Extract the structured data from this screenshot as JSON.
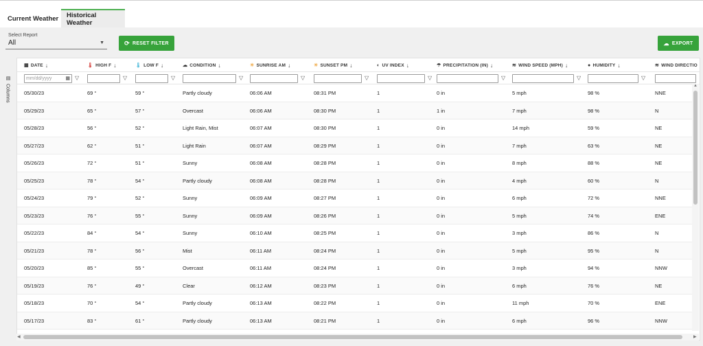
{
  "tabs": [
    {
      "label": "Current Weather"
    },
    {
      "label": "Historical Weather"
    }
  ],
  "report": {
    "label": "Select Report",
    "value": "All"
  },
  "buttons": {
    "reset": "RESET FILTER",
    "export": "EXPORT"
  },
  "sidebar": {
    "columns_label": "Columns"
  },
  "columns": [
    {
      "label": "DATE",
      "icon": "calendar-icon"
    },
    {
      "label": "HIGH F",
      "icon": "thermometer-hot-icon"
    },
    {
      "label": "LOW F",
      "icon": "thermometer-cold-icon"
    },
    {
      "label": "CONDITION",
      "icon": "cloud-icon"
    },
    {
      "label": "SUNRISE AM",
      "icon": "sunrise-icon"
    },
    {
      "label": "SUNSET PM",
      "icon": "sunset-icon"
    },
    {
      "label": "UV INDEX",
      "icon": "uv-icon"
    },
    {
      "label": "PRECIPITATION (IN)",
      "icon": "umbrella-icon"
    },
    {
      "label": "WIND SPEED (MPH)",
      "icon": "wind-icon"
    },
    {
      "label": "HUMIDITY",
      "icon": "droplet-icon"
    },
    {
      "label": "WIND DIRECTIO",
      "icon": "wind-direction-icon"
    }
  ],
  "filter": {
    "date_placeholder": "mm/dd/yyyy"
  },
  "rows": [
    [
      "05/30/23",
      "69 °",
      "59 °",
      "Partly cloudy",
      "06:06 AM",
      "08:31 PM",
      "1",
      "0 in",
      "5 mph",
      "98 %",
      "NNE"
    ],
    [
      "05/29/23",
      "65 °",
      "57 °",
      "Overcast",
      "06:06 AM",
      "08:30 PM",
      "1",
      "1 in",
      "7 mph",
      "98 %",
      "N"
    ],
    [
      "05/28/23",
      "56 °",
      "52 °",
      "Light Rain, Mist",
      "06:07 AM",
      "08:30 PM",
      "1",
      "0 in",
      "14 mph",
      "59 %",
      "NE"
    ],
    [
      "05/27/23",
      "62 °",
      "51 °",
      "Light Rain",
      "06:07 AM",
      "08:29 PM",
      "1",
      "0 in",
      "7 mph",
      "63 %",
      "NE"
    ],
    [
      "05/26/23",
      "72 °",
      "51 °",
      "Sunny",
      "06:08 AM",
      "08:28 PM",
      "1",
      "0 in",
      "8 mph",
      "88 %",
      "NE"
    ],
    [
      "05/25/23",
      "78 °",
      "54 °",
      "Partly cloudy",
      "06:08 AM",
      "08:28 PM",
      "1",
      "0 in",
      "4 mph",
      "60 %",
      "N"
    ],
    [
      "05/24/23",
      "79 °",
      "52 °",
      "Sunny",
      "06:09 AM",
      "08:27 PM",
      "1",
      "0 in",
      "6 mph",
      "72 %",
      "NNE"
    ],
    [
      "05/23/23",
      "76 °",
      "55 °",
      "Sunny",
      "06:09 AM",
      "08:26 PM",
      "1",
      "0 in",
      "5 mph",
      "74 %",
      "ENE"
    ],
    [
      "05/22/23",
      "84 °",
      "54 °",
      "Sunny",
      "06:10 AM",
      "08:25 PM",
      "1",
      "0 in",
      "3 mph",
      "86 %",
      "N"
    ],
    [
      "05/21/23",
      "78 °",
      "56 °",
      "Mist",
      "06:11 AM",
      "08:24 PM",
      "1",
      "0 in",
      "5 mph",
      "95 %",
      "N"
    ],
    [
      "05/20/23",
      "85 °",
      "55 °",
      "Overcast",
      "06:11 AM",
      "08:24 PM",
      "1",
      "0 in",
      "3 mph",
      "94 %",
      "NNW"
    ],
    [
      "05/19/23",
      "76 °",
      "49 °",
      "Clear",
      "06:12 AM",
      "08:23 PM",
      "1",
      "0 in",
      "6 mph",
      "76 %",
      "NE"
    ],
    [
      "05/18/23",
      "70 °",
      "54 °",
      "Partly cloudy",
      "06:13 AM",
      "08:22 PM",
      "1",
      "0 in",
      "11 mph",
      "70 %",
      "ENE"
    ],
    [
      "05/17/23",
      "83 °",
      "61 °",
      "Partly cloudy",
      "06:13 AM",
      "08:21 PM",
      "1",
      "0 in",
      "6 mph",
      "96 %",
      "NNW"
    ]
  ],
  "colors": {
    "accent": "#37a33b",
    "tab_underline": "#4caf50",
    "hot": "#d9534f",
    "cold": "#5bc0de",
    "sun": "#f0ad4e"
  }
}
